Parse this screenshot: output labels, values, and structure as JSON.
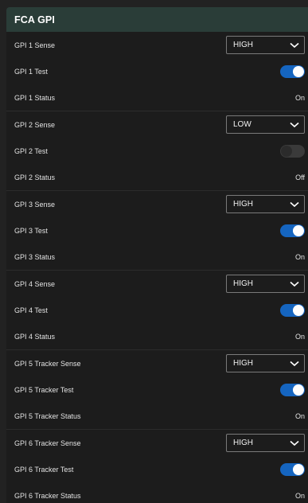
{
  "panel": {
    "title": "FCA GPI"
  },
  "gpis": [
    {
      "sense_label": "GPI 1 Sense",
      "sense_value": "HIGH",
      "test_label": "GPI 1 Test",
      "test_on": true,
      "status_label": "GPI 1 Status",
      "status_value": "On"
    },
    {
      "sense_label": "GPI 2 Sense",
      "sense_value": "LOW",
      "test_label": "GPI 2 Test",
      "test_on": false,
      "status_label": "GPI 2 Status",
      "status_value": "Off"
    },
    {
      "sense_label": "GPI 3 Sense",
      "sense_value": "HIGH",
      "test_label": "GPI 3 Test",
      "test_on": true,
      "status_label": "GPI 3 Status",
      "status_value": "On"
    },
    {
      "sense_label": "GPI 4 Sense",
      "sense_value": "HIGH",
      "test_label": "GPI 4 Test",
      "test_on": true,
      "status_label": "GPI 4 Status",
      "status_value": "On"
    },
    {
      "sense_label": "GPI 5  Tracker Sense",
      "sense_value": "HIGH",
      "test_label": "GPI 5 Tracker Test",
      "test_on": true,
      "status_label": "GPI 5 Tracker Status",
      "status_value": "On"
    },
    {
      "sense_label": "GPI 6 Tracker Sense",
      "sense_value": "HIGH",
      "test_label": "GPI 6 Tracker Test",
      "test_on": true,
      "status_label": "GPI 6 Tracker Status",
      "status_value": "On"
    }
  ],
  "colors": {
    "header_bg": "#2a3d38",
    "toggle_on": "#1565c0",
    "toggle_off": "#3a3a3a"
  },
  "icons": {
    "dropdown": "chevron-down-icon"
  }
}
